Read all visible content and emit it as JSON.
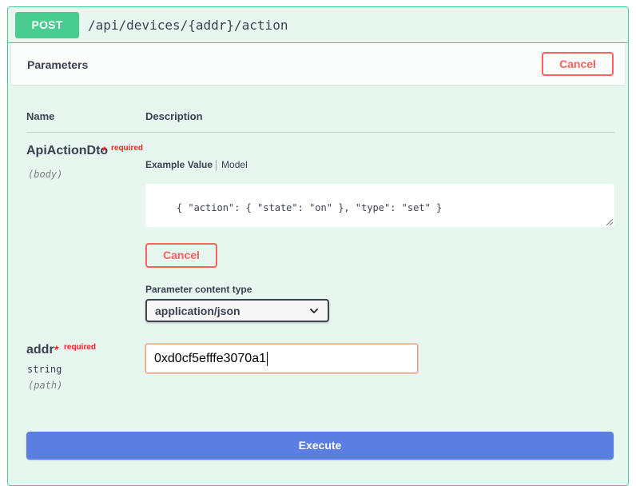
{
  "operation": {
    "method": "POST",
    "path": "/api/devices/{addr}/action"
  },
  "parameters_section": {
    "title": "Parameters",
    "cancel_label": "Cancel"
  },
  "table": {
    "col_name": "Name",
    "col_description": "Description"
  },
  "params": [
    {
      "name": "ApiActionDto",
      "required_star": "*",
      "required_label": "required",
      "in": "(body)",
      "tabs": {
        "active": "Example Value",
        "inactive": "Model"
      },
      "example_value": "{ \"action\": { \"state\": \"on\" }, \"type\": \"set\" }",
      "cancel_label": "Cancel",
      "content_type_label": "Parameter content type",
      "content_type_selected": "application/json"
    },
    {
      "name": "addr",
      "required_star": "*",
      "required_label": "required",
      "type": "string",
      "in": "(path)",
      "value": "0xd0cf5efffe3070a1"
    }
  ],
  "execute_label": "Execute",
  "colors": {
    "post_green": "#49cc90",
    "block_bg": "#e8f6f0",
    "cancel_red": "#ff6060",
    "required_red": "#ff2020",
    "execute_blue": "#5b7fe0"
  }
}
